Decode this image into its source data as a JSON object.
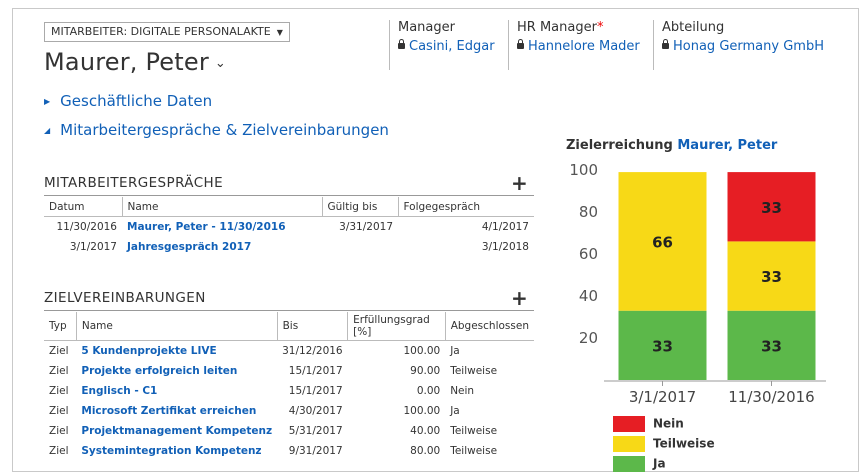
{
  "header": {
    "form_selector": "MITARBEITER: DIGITALE PERSONALAKTE",
    "record_name": "Maurer, Peter",
    "fields": [
      {
        "label": "Manager",
        "required": false,
        "value": "Casini, Edgar"
      },
      {
        "label": "HR Manager",
        "required": true,
        "value": "Hannelore Mader"
      },
      {
        "label": "Abteilung",
        "required": false,
        "value": "Honag Germany GmbH"
      }
    ]
  },
  "sections": [
    {
      "label": "Geschäftliche Daten",
      "expanded": false
    },
    {
      "label": "Mitarbeitergespräche & Zielvereinbarungen",
      "expanded": true
    }
  ],
  "gespraeche": {
    "title": "MITARBEITERGESPRÄCHE",
    "add_label": "+",
    "columns": [
      "Datum",
      "Name",
      "Gültig bis",
      "Folgegespräch"
    ],
    "rows": [
      [
        "11/30/2016",
        "Maurer, Peter - 11/30/2016",
        "3/31/2017",
        "4/1/2017"
      ],
      [
        "3/1/2017",
        "Jahresgespräch 2017",
        "",
        "3/1/2018"
      ]
    ]
  },
  "ziele": {
    "title": "ZIELVEREINBARUNGEN",
    "add_label": "+",
    "columns": [
      "Typ",
      "Name",
      "Bis",
      "Erfüllungsgrad [%]",
      "Abgeschlossen"
    ],
    "rows": [
      [
        "Ziel",
        "5 Kundenprojekte LIVE",
        "31/12/2016",
        "100.00",
        "Ja"
      ],
      [
        "Ziel",
        "Projekte erfolgreich leiten",
        "15/1/2017",
        "90.00",
        "Teilweise"
      ],
      [
        "Ziel",
        "Englisch - C1",
        "15/1/2017",
        "0.00",
        "Nein"
      ],
      [
        "Ziel",
        "Microsoft Zertifikat erreichen",
        "4/30/2017",
        "100.00",
        "Ja"
      ],
      [
        "Ziel",
        "Projektmanagement Kompetenz",
        "5/31/2017",
        "40.00",
        "Teilweise"
      ],
      [
        "Ziel",
        "Systemintegration Kompetenz",
        "9/31/2017",
        "80.00",
        "Teilweise"
      ]
    ]
  },
  "chart_data": {
    "type": "bar",
    "stacked": true,
    "title": "Zielerreichung",
    "title_highlight": "Maurer, Peter",
    "categories": [
      "3/1/2017",
      "11/30/2016"
    ],
    "series": [
      {
        "name": "Ja",
        "color": "#5cb84a",
        "values": [
          33,
          33
        ]
      },
      {
        "name": "Teilweise",
        "color": "#f7d917",
        "values": [
          66,
          33
        ]
      },
      {
        "name": "Nein",
        "color": "#e61e24",
        "values": [
          0,
          33
        ]
      }
    ],
    "ylim": [
      0,
      100
    ],
    "yticks": [
      20,
      40,
      60,
      80,
      100
    ],
    "legend_position": "bottom",
    "legend_order": [
      "Nein",
      "Teilweise",
      "Ja"
    ]
  }
}
